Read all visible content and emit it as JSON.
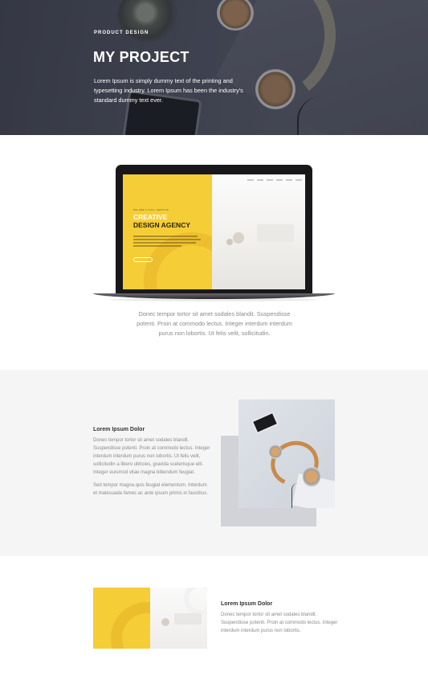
{
  "hero": {
    "eyebrow": "PRODUCT DESIGN",
    "title": "MY PROJECT",
    "description": "Lorem Ipsum is simply dummy text of the printing and typesetting industry. Lorem Ipsum has been the industry's standard dummy text ever."
  },
  "laptop_screen": {
    "eyebrow": "WE ARE A FULL SERVICE",
    "line1": "CREATIVE",
    "line2": "DESIGN AGENCY"
  },
  "laptop_section": {
    "caption": "Donec tempor tortor sit amet sodales blandit. Suspendisse potenti. Proin at commodo lectus. Integer interdum interdum purus non lobortis. Ut felis velit, sollicitudin."
  },
  "feature_one": {
    "heading": "Lorem Ipsum Dolor",
    "paragraph1": "Donec tempor tortor sit amet sodales blandit. Suspendisse potenti. Proin at commodo lectus. Integer interdum interdum purus non lobortis. Ut felis velit, sollicitudin a libero ultricies, gravida scelerisque elit. Integer euismod vitae magna bibendum feugiat.",
    "paragraph2": "Sed tempor magna quis feugiat elementum. Interdum et malesuada fames ac ante ipsum primis in faucibus."
  },
  "feature_two": {
    "heading": "Lorem Ipsum Dolor",
    "paragraph": "Donec tempor tortor sit amet sodales blandit. Suspendisse potenti. Proin at commodo lectus. Integer interdum interdum purus non lobortis."
  },
  "colors": {
    "hero_overlay": "#3c3f4c",
    "accent_yellow": "#f5cd37",
    "section_grey": "#f5f5f5",
    "shape_grey": "#d1d3d8"
  }
}
